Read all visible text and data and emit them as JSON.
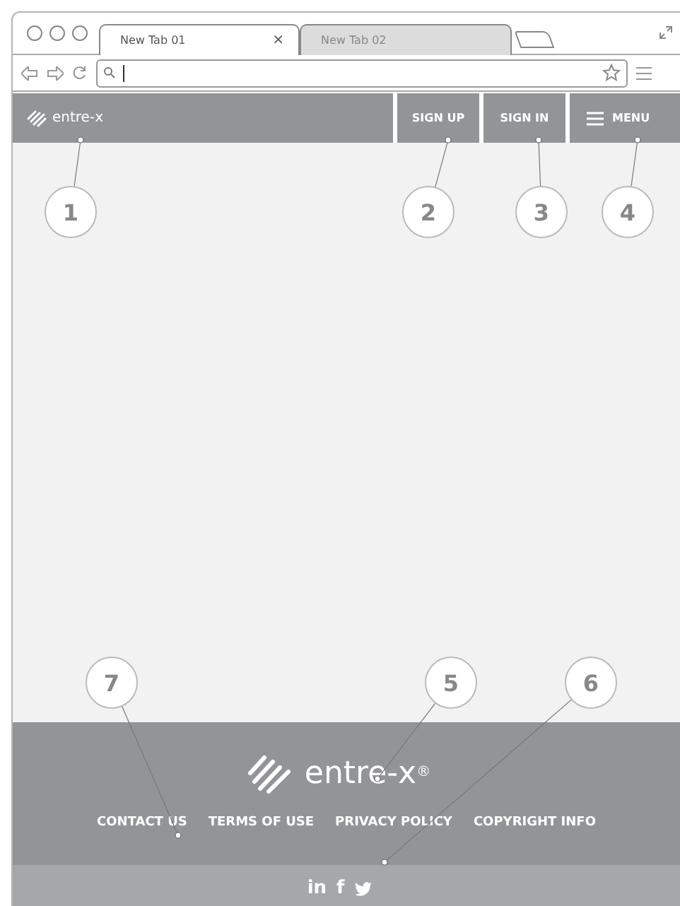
{
  "browser": {
    "tabs": [
      {
        "label": "New Tab 01",
        "selected": true,
        "close": "×"
      },
      {
        "label": "New Tab 02",
        "selected": false
      }
    ]
  },
  "header": {
    "brand": "entre-x",
    "nav": [
      {
        "label": "SIGN UP",
        "kind": "text"
      },
      {
        "label": "SIGN IN",
        "kind": "text"
      },
      {
        "label": "MENU",
        "kind": "menu"
      }
    ]
  },
  "footer": {
    "brand": "entre-x$^{®}$",
    "links": [
      "CONTACT US",
      "TERMS OF USE",
      "PRIVACY POLICY",
      "COPYRIGHT INFO"
    ],
    "social": [
      {
        "label": "in"
      },
      {
        "label": "f"
      },
      {
        "kind": "twitter"
      }
    ]
  },
  "annotations": [
    {
      "number": "1"
    },
    {
      "number": "2"
    },
    {
      "number": "3"
    },
    {
      "number": "4"
    },
    {
      "number": "7"
    },
    {
      "number": "5"
    },
    {
      "number": "6"
    }
  ]
}
